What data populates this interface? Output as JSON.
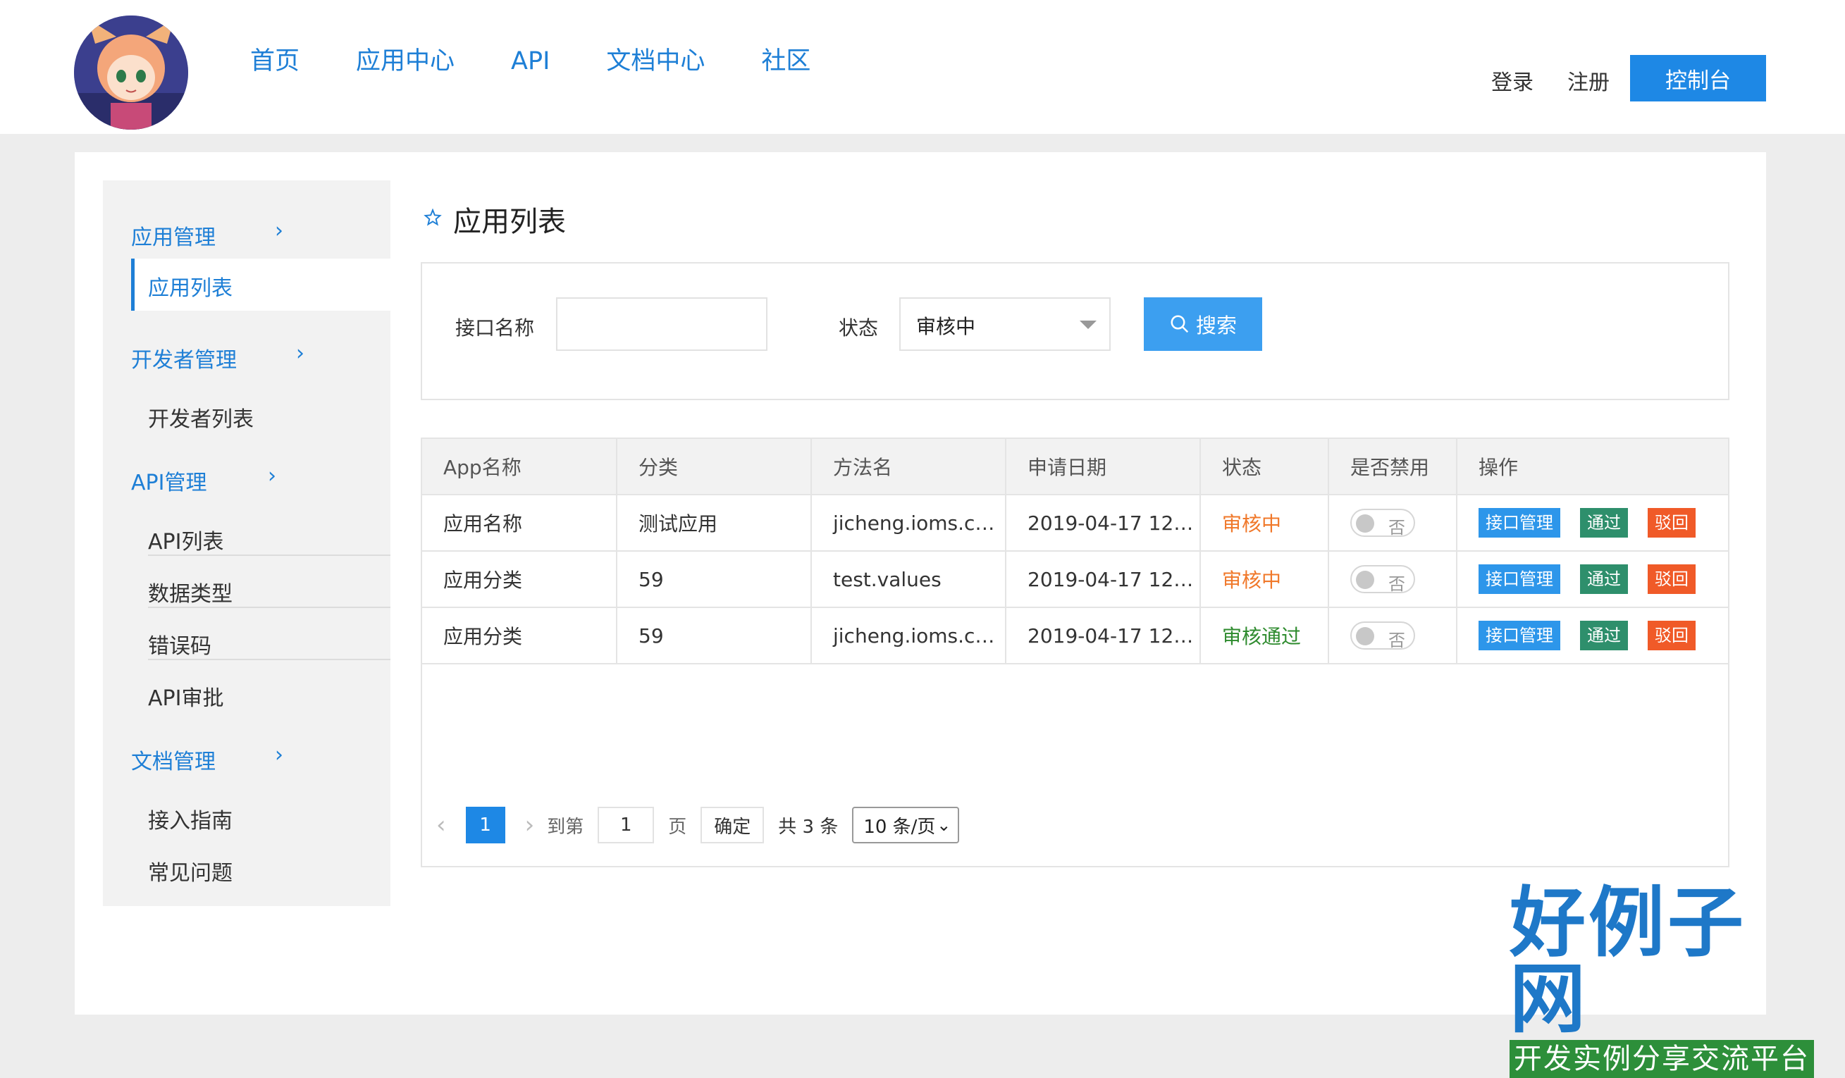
{
  "header": {
    "nav": [
      "首页",
      "应用中心",
      "API",
      "文档中心",
      "社区"
    ],
    "login": "登录",
    "register": "注册",
    "console": "控制台"
  },
  "sidebar": {
    "groups": [
      {
        "label": "应用管理",
        "items": [
          "应用列表"
        ]
      },
      {
        "label": "开发者管理",
        "items": [
          "开发者列表"
        ]
      },
      {
        "label": "API管理",
        "items": [
          "API列表",
          "数据类型",
          "错误码",
          "API审批"
        ]
      },
      {
        "label": "文档管理",
        "items": [
          "接入指南",
          "常见问题"
        ]
      }
    ],
    "chevron": "›"
  },
  "page": {
    "title": "应用列表"
  },
  "filter": {
    "name_label": "接口名称",
    "name_value": "",
    "status_label": "状态",
    "status_value": "审核中",
    "search_button": "搜索"
  },
  "table": {
    "headers": [
      "App名称",
      "分类",
      "方法名",
      "申请日期",
      "状态",
      "是否禁用",
      "操作"
    ],
    "rows": [
      {
        "app": "应用名称",
        "category": "测试应用",
        "method": "jicheng.ioms.c…",
        "date": "2019-04-17 12…",
        "status": "审核中",
        "disabled": "否"
      },
      {
        "app": "应用分类",
        "category": "59",
        "method": "test.values",
        "date": "2019-04-17 12…",
        "status": "审核中",
        "disabled": "否"
      },
      {
        "app": "应用分类",
        "category": "59",
        "method": "jicheng.ioms.c…",
        "date": "2019-04-17 12…",
        "status": "审核通过",
        "disabled": "否"
      }
    ],
    "actions": {
      "manage": "接口管理",
      "pass": "通过",
      "reject": "驳回"
    }
  },
  "pagination": {
    "current_page": "1",
    "goto_label": "到第",
    "goto_value": "1",
    "page_unit": "页",
    "confirm": "确定",
    "total": "共 3 条",
    "page_size": "10 条/页"
  },
  "watermark": {
    "title": "好例子网",
    "subtitle": "开发实例分享交流平台"
  },
  "colors": {
    "accent": "#1e88e5",
    "nav_blue": "#1e7fd6",
    "pending": "#f0782a",
    "passed": "#2e8b2e"
  }
}
